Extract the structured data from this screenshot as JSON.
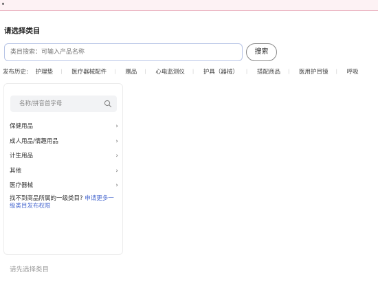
{
  "page": {
    "section_title": "请选择类目",
    "footer_hint": "请先选择类目"
  },
  "search": {
    "placeholder": "类目搜索：可输入产品名称",
    "button_label": "搜索"
  },
  "history": {
    "label": "发布历史:",
    "items": [
      "护理垫",
      "医疗器械配件",
      "赠品",
      "心电监测仪",
      "护具（器械）",
      "搭配商品",
      "医用护目镜",
      "呼吸"
    ]
  },
  "category_panel": {
    "search_placeholder": "名称/拼音首字母",
    "items": [
      {
        "label": "保健用品"
      },
      {
        "label": "成人用品/情趣用品"
      },
      {
        "label": "计生用品"
      },
      {
        "label": "其他"
      },
      {
        "label": "医疗器械"
      }
    ],
    "chevron": "›",
    "notice_text": "找不到商品所属的一级类目?",
    "notice_link": "申请更多一级类目发布权限"
  },
  "colors": {
    "accent_link": "#4f6ed1",
    "input_border": "#b7c4e6",
    "top_strip_border": "#e9adbb"
  }
}
